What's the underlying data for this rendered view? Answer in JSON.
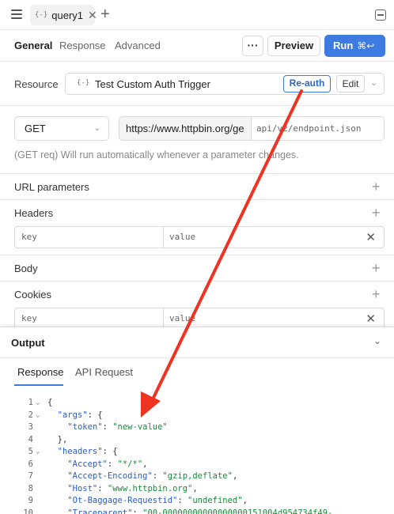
{
  "topbar": {
    "tab_label": "query1",
    "tab_icon": "{-}",
    "close_glyph": "✕",
    "add_glyph": "+"
  },
  "subtabs": {
    "items": [
      "General",
      "Response",
      "Advanced"
    ],
    "active": "General",
    "more_label": "···",
    "preview_label": "Preview",
    "run_label": "Run",
    "run_shortcut": "⌘↩"
  },
  "resource": {
    "label": "Resource",
    "icon": "{-}",
    "name": "Test Custom Auth Trigger",
    "reauth_label": "Re-auth",
    "edit_label": "Edit"
  },
  "request": {
    "method": "GET",
    "url_base": "https://www.httpbin.org/ge",
    "url_path": "api/v2/endpoint.json",
    "hint": "(GET req) Will run automatically whenever a parameter changes."
  },
  "sections": {
    "url_parameters": "URL parameters",
    "headers": "Headers",
    "body": "Body",
    "cookies": "Cookies",
    "key_placeholder": "key",
    "value_placeholder": "value"
  },
  "output": {
    "title": "Output",
    "tabs": [
      "Response",
      "API Request"
    ],
    "active_tab": "Response",
    "lines": [
      {
        "n": "1",
        "fold": "v",
        "indent": "",
        "parts": [
          [
            "pun",
            "{"
          ]
        ]
      },
      {
        "n": "2",
        "fold": "v",
        "indent": "  ",
        "parts": [
          [
            "key",
            "\"args\""
          ],
          [
            "pun",
            ": {"
          ]
        ]
      },
      {
        "n": "3",
        "fold": "",
        "indent": "    ",
        "parts": [
          [
            "key",
            "\"token\""
          ],
          [
            "pun",
            ": "
          ],
          [
            "str",
            "\"new-value\""
          ]
        ]
      },
      {
        "n": "4",
        "fold": "",
        "indent": "  ",
        "parts": [
          [
            "pun",
            "},"
          ]
        ]
      },
      {
        "n": "5",
        "fold": "v",
        "indent": "  ",
        "parts": [
          [
            "key",
            "\"headers\""
          ],
          [
            "pun",
            ": {"
          ]
        ]
      },
      {
        "n": "6",
        "fold": "",
        "indent": "    ",
        "parts": [
          [
            "key",
            "\"Accept\""
          ],
          [
            "pun",
            ": "
          ],
          [
            "str",
            "\"*/*\""
          ],
          [
            "pun",
            ","
          ]
        ]
      },
      {
        "n": "7",
        "fold": "",
        "indent": "    ",
        "parts": [
          [
            "key",
            "\"Accept-Encoding\""
          ],
          [
            "pun",
            ": "
          ],
          [
            "str",
            "\"gzip,deflate\""
          ],
          [
            "pun",
            ","
          ]
        ]
      },
      {
        "n": "8",
        "fold": "",
        "indent": "    ",
        "parts": [
          [
            "key",
            "\"Host\""
          ],
          [
            "pun",
            ": "
          ],
          [
            "str",
            "\"www.httpbin.org\""
          ],
          [
            "pun",
            ","
          ]
        ]
      },
      {
        "n": "9",
        "fold": "",
        "indent": "    ",
        "parts": [
          [
            "key",
            "\"Ot-Baggage-Requestid\""
          ],
          [
            "pun",
            ": "
          ],
          [
            "str",
            "\"undefined\""
          ],
          [
            "pun",
            ","
          ]
        ]
      },
      {
        "n": "10",
        "fold": "",
        "indent": "    ",
        "parts": [
          [
            "key",
            "\"Traceparent\""
          ],
          [
            "pun",
            ": "
          ],
          [
            "str",
            "\"00-00000000000000000151004d954734f49-"
          ]
        ]
      }
    ]
  },
  "colors": {
    "accent": "#3d7be0",
    "annotation_arrow": "#ee3322"
  }
}
